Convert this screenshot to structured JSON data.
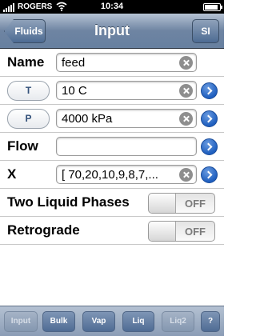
{
  "status": {
    "carrier": "ROGERS",
    "time": "10:34",
    "battery_level": 0.9
  },
  "nav": {
    "back_label": "Fluids",
    "title": "Input",
    "right_label": "SI"
  },
  "rows": {
    "name": {
      "label": "Name",
      "value": "feed"
    },
    "t": {
      "button": "T",
      "value": "10 C"
    },
    "p": {
      "button": "P",
      "value": "4000 kPa"
    },
    "flow": {
      "label": "Flow",
      "value": ""
    },
    "x": {
      "label": "X",
      "value": "[ 70,20,10,9,8,7,..."
    },
    "two_liquid": {
      "label": "Two Liquid Phases",
      "state": "OFF"
    },
    "retrograde": {
      "label": "Retrograde",
      "state": "OFF"
    }
  },
  "tabs": [
    {
      "label": "Input",
      "enabled": false
    },
    {
      "label": "Bulk",
      "enabled": true
    },
    {
      "label": "Vap",
      "enabled": true
    },
    {
      "label": "Liq",
      "enabled": true
    },
    {
      "label": "Liq2",
      "enabled": false
    },
    {
      "label": "?",
      "enabled": true
    }
  ],
  "colors": {
    "nav_bar": "#6e84a2",
    "disclosure": "#1f5fbf",
    "tab_button": "#4f6c94"
  }
}
